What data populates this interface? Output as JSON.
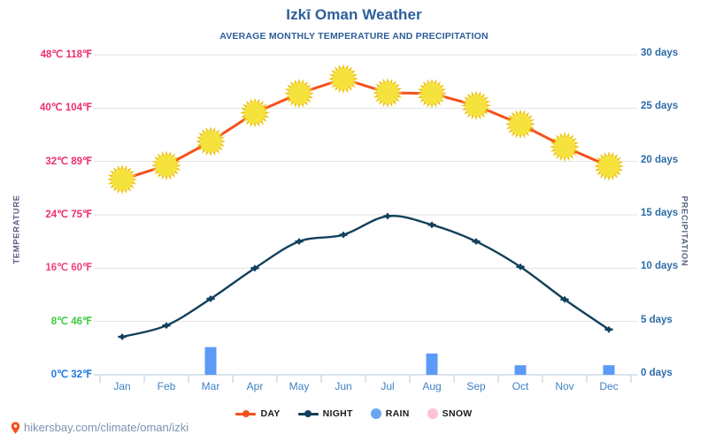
{
  "chart_data": {
    "type": "line",
    "title": "Izkī Oman Weather",
    "subtitle": "AVERAGE MONTHLY TEMPERATURE AND PRECIPITATION",
    "xlabel": "",
    "ylabel": "TEMPERATURE",
    "y2label": "PRECIPITATION",
    "grid": true,
    "legend_position": "bottom",
    "categories": [
      "Jan",
      "Feb",
      "Mar",
      "Apr",
      "May",
      "Jun",
      "Jul",
      "Aug",
      "Sep",
      "Oct",
      "Nov",
      "Dec"
    ],
    "ylim": [
      0,
      48
    ],
    "y2lim": [
      0,
      30
    ],
    "yticks_left": [
      {
        "label": "48℃ 118℉",
        "celsius": 48,
        "fahrenheit": 118,
        "color": "#ed2e6e"
      },
      {
        "label": "40℃ 104℉",
        "celsius": 40,
        "fahrenheit": 104,
        "color": "#ed2e6e"
      },
      {
        "label": "32℃ 89℉",
        "celsius": 32,
        "fahrenheit": 89,
        "color": "#ed2e6e"
      },
      {
        "label": "24℃ 75℉",
        "celsius": 24,
        "fahrenheit": 75,
        "color": "#ed2e6e"
      },
      {
        "label": "16℃ 60℉",
        "celsius": 16,
        "fahrenheit": 60,
        "color": "#f0407a"
      },
      {
        "label": "8℃ 46℉",
        "celsius": 8,
        "fahrenheit": 46,
        "color": "#3ec93e"
      },
      {
        "label": "0℃ 32℉",
        "celsius": 0,
        "fahrenheit": 32,
        "color": "#1f7ae0"
      }
    ],
    "yticks_right": [
      {
        "label": "30 days",
        "value": 30
      },
      {
        "label": "25 days",
        "value": 25
      },
      {
        "label": "20 days",
        "value": 20
      },
      {
        "label": "15 days",
        "value": 15
      },
      {
        "label": "10 days",
        "value": 10
      },
      {
        "label": "5 days",
        "value": 5
      },
      {
        "label": "0 days",
        "value": 0
      }
    ],
    "series": [
      {
        "name": "DAY",
        "key": "day",
        "unit": "℃",
        "color": "#f4511e",
        "marker": "sun",
        "values": [
          29.3,
          31.4,
          35.0,
          39.3,
          42.2,
          44.4,
          42.3,
          42.2,
          40.4,
          37.6,
          34.2,
          31.3
        ]
      },
      {
        "name": "NIGHT",
        "key": "night",
        "unit": "℃",
        "color": "#12405c",
        "marker": "diamond",
        "values": [
          5.7,
          7.4,
          11.4,
          16.0,
          20.0,
          21.0,
          23.8,
          22.5,
          20.0,
          16.2,
          11.3,
          6.8
        ]
      },
      {
        "name": "RAIN",
        "key": "rain",
        "unit": "days",
        "color": "#5b9bf7",
        "marker": "bar",
        "values": [
          0,
          0,
          2.6,
          0,
          0,
          0,
          0,
          2.0,
          0,
          0.9,
          0,
          0.9
        ]
      },
      {
        "name": "SNOW",
        "key": "snow",
        "unit": "days",
        "color": "#fbc2d4",
        "marker": "bar",
        "values": [
          0,
          0,
          0,
          0,
          0,
          0,
          0,
          0,
          0,
          0,
          0,
          0
        ]
      }
    ]
  },
  "legend": [
    {
      "label": "DAY",
      "type": "line",
      "color": "#f4511e"
    },
    {
      "label": "NIGHT",
      "type": "line",
      "color": "#12405c"
    },
    {
      "label": "RAIN",
      "type": "circle",
      "color": "#6aa6f0"
    },
    {
      "label": "SNOW",
      "type": "circle",
      "color": "#fbc2d4"
    }
  ],
  "footer": {
    "url": "hikersbay.com/climate/oman/izki",
    "icon": "location-pin-icon"
  },
  "colors": {
    "title": "#2d5f9a",
    "grid": "#e2e2e2",
    "axis": "#c8d4e4",
    "sun_fill": "#f5e23c",
    "sun_ray": "#f0c419",
    "day_line": "#f4511e",
    "night_line": "#12405c",
    "rain_bar": "#5b9bf7",
    "month_label": "#3d82c4",
    "footer_text": "#7d93b0",
    "pin": "#f4511e"
  }
}
